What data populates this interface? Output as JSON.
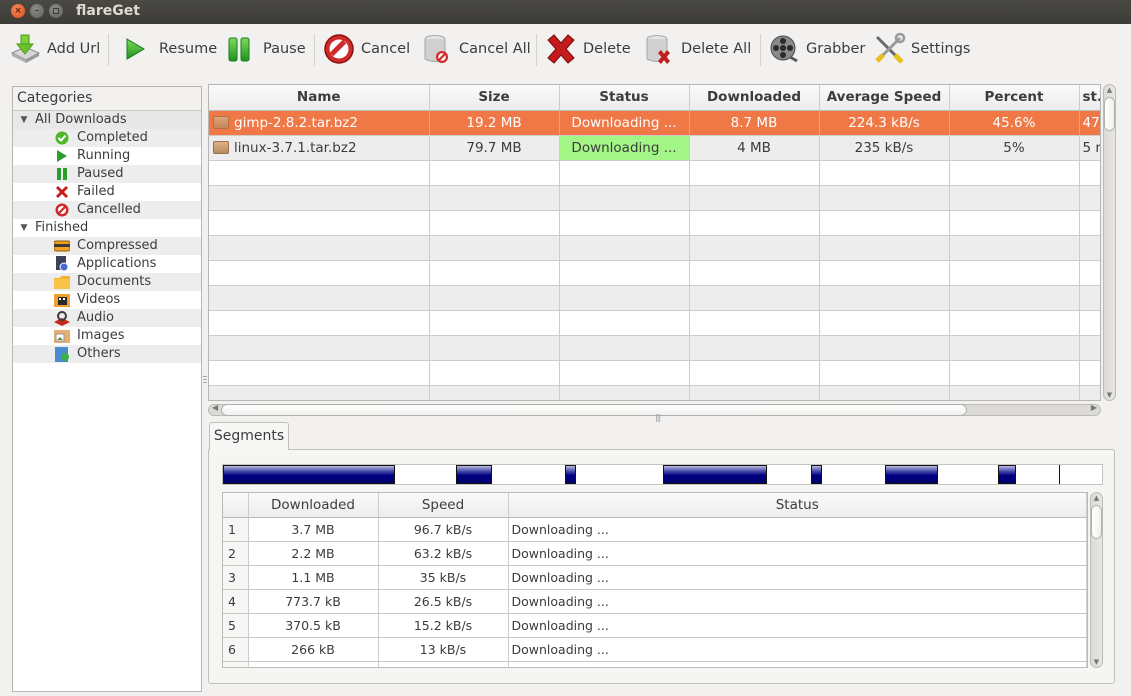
{
  "window": {
    "title": "flareGet"
  },
  "toolbar": {
    "items": [
      {
        "label": "Add Url",
        "icon": "add-url-icon"
      },
      {
        "label": "Resume",
        "icon": "play-icon"
      },
      {
        "label": "Pause",
        "icon": "pause-icon"
      },
      {
        "label": "Cancel",
        "icon": "cancel-icon"
      },
      {
        "label": "Cancel All",
        "icon": "cancel-all-icon"
      },
      {
        "label": "Delete",
        "icon": "delete-icon"
      },
      {
        "label": "Delete All",
        "icon": "delete-all-icon"
      },
      {
        "label": "Grabber",
        "icon": "film-reel-icon"
      },
      {
        "label": "Settings",
        "icon": "settings-tools-icon"
      }
    ]
  },
  "sidebar": {
    "header": "Categories",
    "groups": [
      {
        "label": "All Downloads",
        "expanded": true,
        "items": [
          {
            "label": "Completed",
            "icon": "check-icon"
          },
          {
            "label": "Running",
            "icon": "play-icon"
          },
          {
            "label": "Paused",
            "icon": "pause-icon"
          },
          {
            "label": "Failed",
            "icon": "x-icon"
          },
          {
            "label": "Cancelled",
            "icon": "cancel-icon"
          }
        ]
      },
      {
        "label": "Finished",
        "expanded": true,
        "items": [
          {
            "label": "Compressed",
            "icon": "archive-icon"
          },
          {
            "label": "Applications",
            "icon": "application-icon"
          },
          {
            "label": "Documents",
            "icon": "folder-icon"
          },
          {
            "label": "Videos",
            "icon": "video-icon"
          },
          {
            "label": "Audio",
            "icon": "audio-icon"
          },
          {
            "label": "Images",
            "icon": "image-icon"
          },
          {
            "label": "Others",
            "icon": "others-icon"
          }
        ]
      }
    ]
  },
  "downloads": {
    "columns": [
      "Name",
      "Size",
      "Status",
      "Downloaded",
      "Average Speed",
      "Percent",
      "st."
    ],
    "rows": [
      {
        "name": "gimp-2.8.2.tar.bz2",
        "size": "19.2 MB",
        "status": "Downloading ...",
        "downloaded": "8.7 MB",
        "avg_speed": "224.3 kB/s",
        "percent": "45.6%",
        "extra": "47",
        "selected": true
      },
      {
        "name": "linux-3.7.1.tar.bz2",
        "size": "79.7 MB",
        "status": "Downloading ...",
        "downloaded": "4 MB",
        "avg_speed": "235 kB/s",
        "percent": "5%",
        "extra": "5 r",
        "selected": false
      }
    ],
    "selected_color": "#f07746",
    "status_active_color": "#a3f586"
  },
  "segments": {
    "tab_label": "Segments",
    "progress_blocks": [
      {
        "start": 0.0,
        "end": 0.196
      },
      {
        "start": 0.265,
        "end": 0.306
      },
      {
        "start": 0.389,
        "end": 0.402
      },
      {
        "start": 0.501,
        "end": 0.619
      },
      {
        "start": 0.669,
        "end": 0.682
      },
      {
        "start": 0.753,
        "end": 0.813
      },
      {
        "start": 0.882,
        "end": 0.902
      }
    ],
    "segment_markers": [
      0.951
    ],
    "columns": [
      "",
      "Downloaded",
      "Speed",
      "Status"
    ],
    "rows": [
      {
        "index": "1",
        "downloaded": "3.7 MB",
        "speed": "96.7 kB/s",
        "status": "Downloading ..."
      },
      {
        "index": "2",
        "downloaded": "2.2 MB",
        "speed": "63.2 kB/s",
        "status": "Downloading ..."
      },
      {
        "index": "3",
        "downloaded": "1.1 MB",
        "speed": "35 kB/s",
        "status": "Downloading ..."
      },
      {
        "index": "4",
        "downloaded": "773.7 kB",
        "speed": "26.5 kB/s",
        "status": "Downloading ..."
      },
      {
        "index": "5",
        "downloaded": "370.5 kB",
        "speed": "15.2 kB/s",
        "status": "Downloading ..."
      },
      {
        "index": "6",
        "downloaded": "266 kB",
        "speed": "13 kB/s",
        "status": "Downloading ..."
      }
    ]
  }
}
